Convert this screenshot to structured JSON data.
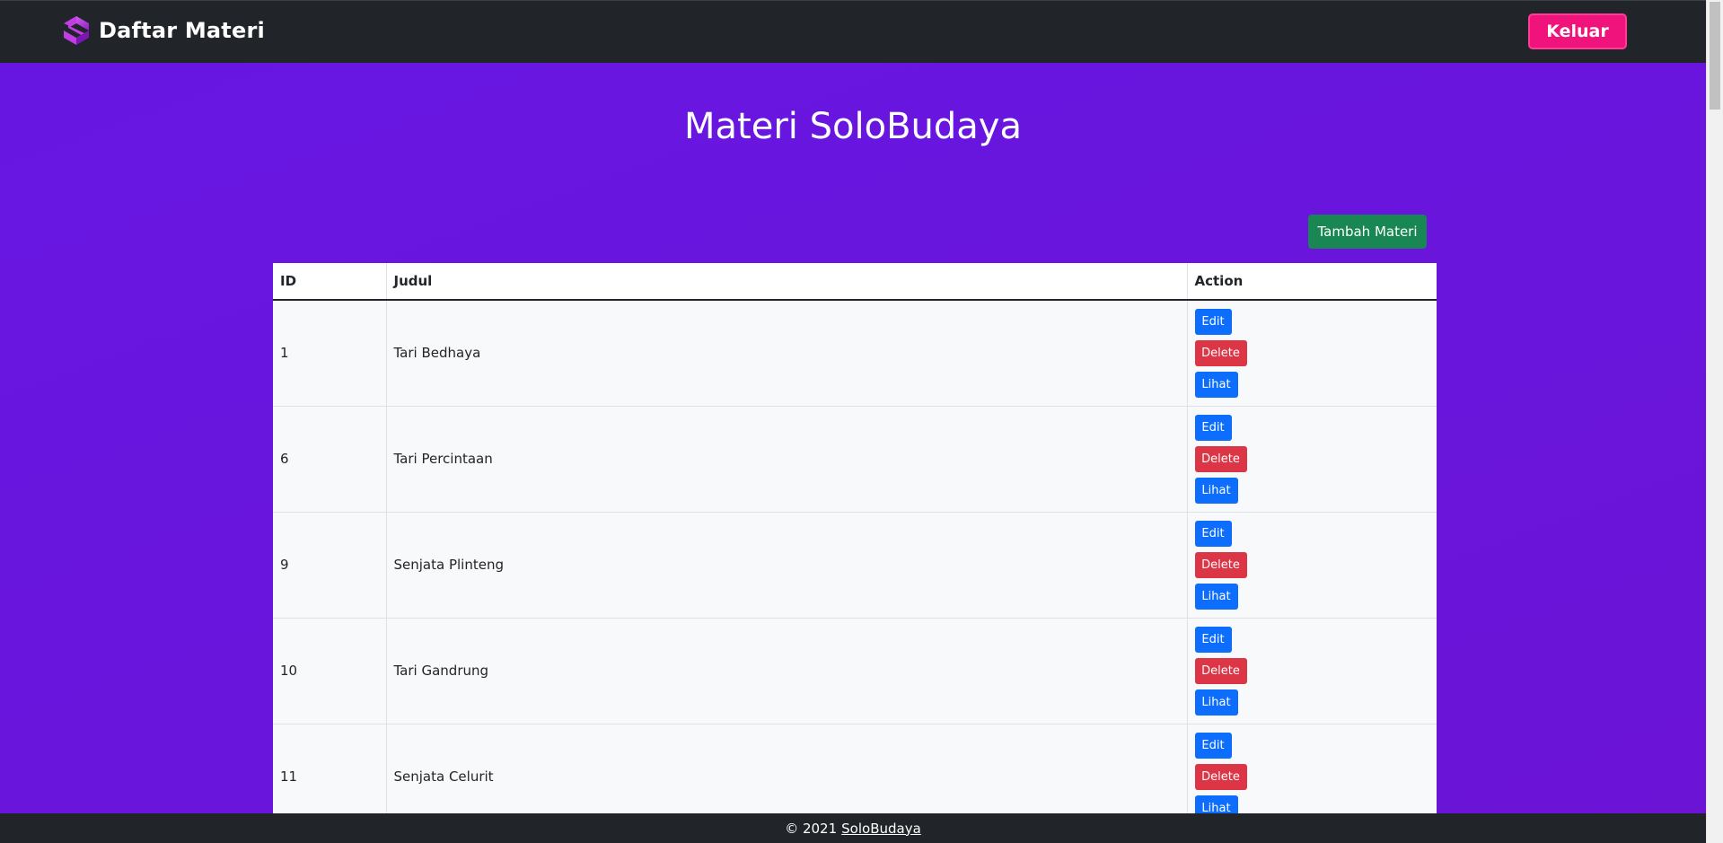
{
  "navbar": {
    "title": "Daftar Materi",
    "logo_icon": "solobudaya-logo-icon",
    "logout_label": "Keluar",
    "logout_color": "#f0137b"
  },
  "main": {
    "heading": "Materi SoloBudaya",
    "add_label": "Tambah Materi",
    "add_color": "#198754"
  },
  "table": {
    "headers": [
      "ID",
      "Judul",
      "Action"
    ],
    "action_labels": {
      "edit": "Edit",
      "delete": "Delete",
      "view": "Lihat"
    },
    "rows": [
      {
        "id": "1",
        "judul": "Tari Bedhaya"
      },
      {
        "id": "6",
        "judul": "Tari Percintaan"
      },
      {
        "id": "9",
        "judul": "Senjata Plinteng"
      },
      {
        "id": "10",
        "judul": "Tari Gandrung"
      },
      {
        "id": "11",
        "judul": "Senjata Celurit"
      }
    ]
  },
  "footer": {
    "copyright": "© 2021",
    "link": "SoloBudaya"
  },
  "colors": {
    "background": "#6716e3",
    "navbar": "#212529",
    "primary": "#0d6efd",
    "danger": "#dc3545"
  }
}
